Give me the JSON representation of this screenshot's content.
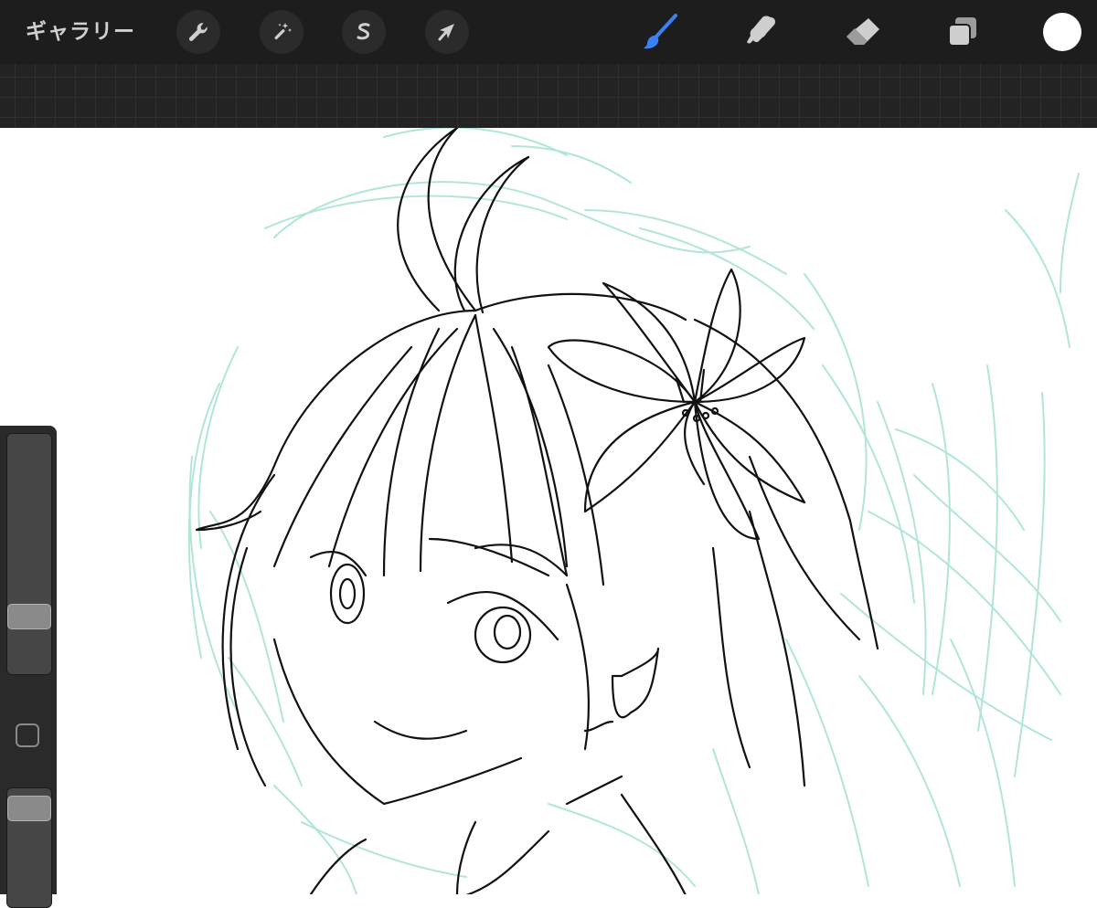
{
  "app": {
    "gallery_label": "ギャラリー"
  },
  "toolbar": {
    "left_tools": [
      {
        "name": "actions",
        "icon": "wrench-icon"
      },
      {
        "name": "adjustments",
        "icon": "magic-wand-icon"
      },
      {
        "name": "selection",
        "icon": "selection-s-icon"
      },
      {
        "name": "transform",
        "icon": "arrow-cursor-icon"
      }
    ],
    "right_tools": [
      {
        "name": "brush",
        "icon": "brush-icon",
        "active": true
      },
      {
        "name": "smudge",
        "icon": "smudge-finger-icon"
      },
      {
        "name": "eraser",
        "icon": "eraser-icon"
      },
      {
        "name": "layers",
        "icon": "layers-icon"
      }
    ],
    "current_color": "#ffffff"
  },
  "colors": {
    "toolbar_bg": "#1d1d1d",
    "active_tool": "#3b82f6",
    "sketch_lines": "#a9e3d6",
    "ink_lines": "#111111"
  },
  "sidebar": {
    "brush_size_level": 0.25,
    "opacity_level": 0.9
  }
}
